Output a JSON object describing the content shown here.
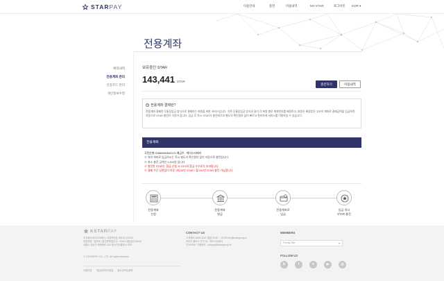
{
  "header": {
    "brand_bold": "STAR",
    "brand_thin": "PAY",
    "nav": [
      "이용안내",
      "충전",
      "이용내역",
      "MY STAR",
      "로그아웃",
      "KOR"
    ]
  },
  "page": {
    "title": "전용계좌"
  },
  "sidebar": {
    "items": [
      {
        "label": "예약내역",
        "active": false
      },
      {
        "label": "전용계좌 관리",
        "active": true
      },
      {
        "label": "인증코드 관리",
        "active": false
      },
      {
        "label": "개인정보수정",
        "active": false
      }
    ]
  },
  "balance": {
    "label": "보유중인 STAR",
    "value": "143,441",
    "unit": "STAR",
    "charge_button": "충전하기",
    "history_button": "이용내역"
  },
  "info": {
    "title": "전용계좌 결제란?",
    "body": "전용계좌 결제란 무통장입금 방식으로 결제하는 회원을 위한 서비스입니다. 기존 무통장입금 방식과 달리 각 회원 별로 계좌번호를 배정하고, 회원은 배정받은 고유의 계좌로 결제금액을 입금하면, 자동으로 STAR 충전이 이루어 집니다. 입금 후 즉시 STAR가 충전되므로 별도의 확인절차 없이 빠르고 편리하게 서비스를 이용하실 수 있습니다."
  },
  "account": {
    "header": "전용계좌",
    "lines": [
      {
        "text": "국민은행 00869085503170 예금주 : 케이스타페이",
        "style": "bold"
      },
      {
        "text": "※ 위의 계좌로 입금하시는 즉시 별도의 확인절차 없이 자동으로 충전됩니다.",
        "style": "normal"
      },
      {
        "text": "※ 최소 충전 금액은 2,500원 입니다.",
        "style": "normal"
      },
      {
        "text": "※ 충전한 STAR는 환급 신청 시 10%의 환급 수수료가 부과됩니다.",
        "style": "red"
      },
      {
        "text": "※ 결제 수단 상관없이 하루 1회 50만 STAR / 월 200만 STAR 충전 가능합니다.",
        "style": "red"
      }
    ]
  },
  "steps": [
    {
      "label": "전용계좌\n신청",
      "icon": "keypad-icon"
    },
    {
      "label": "전용계좌\n발급",
      "icon": "building-icon"
    },
    {
      "label": "전용계좌로\n입금",
      "icon": "card-icon"
    },
    {
      "label": "입금 즉시\nSTAR 충전",
      "icon": "star-coin-icon"
    }
  ],
  "footer": {
    "brand_bold": "KSTAR",
    "brand_thin": "PAY",
    "company_lines": [
      "주식회사케이스타페이  |  사업자번호 486-87-00942",
      "대표자명 : 김모모  |  통신판매업신고 : 2018-서울강남-03010",
      "서울시 강남구 테헤란로 332 한신인터밸리24 리모"
    ],
    "copyright": "ⓒ KSTARPAY CO., LTD. All rights reserved.",
    "contact_heading": "CONTACT US",
    "contact_lines": [
      "고객센터 1899-3337 평일 09:30 ~ 18:30 info@kstargroup.tv",
      "카카오 플러스 친구 ID : 케이스타페이",
      "STARPAY 가맹문의 : starpay@kstargroup.tv"
    ],
    "members_heading": "MEMBERS",
    "family_select": "Family Site",
    "follow_heading": "FOLLOW US",
    "social": [
      "b",
      "f",
      "♥",
      "▶",
      "◎"
    ],
    "links": [
      "이용약관",
      "개인정보처리방침",
      "청소년보호정책"
    ]
  }
}
